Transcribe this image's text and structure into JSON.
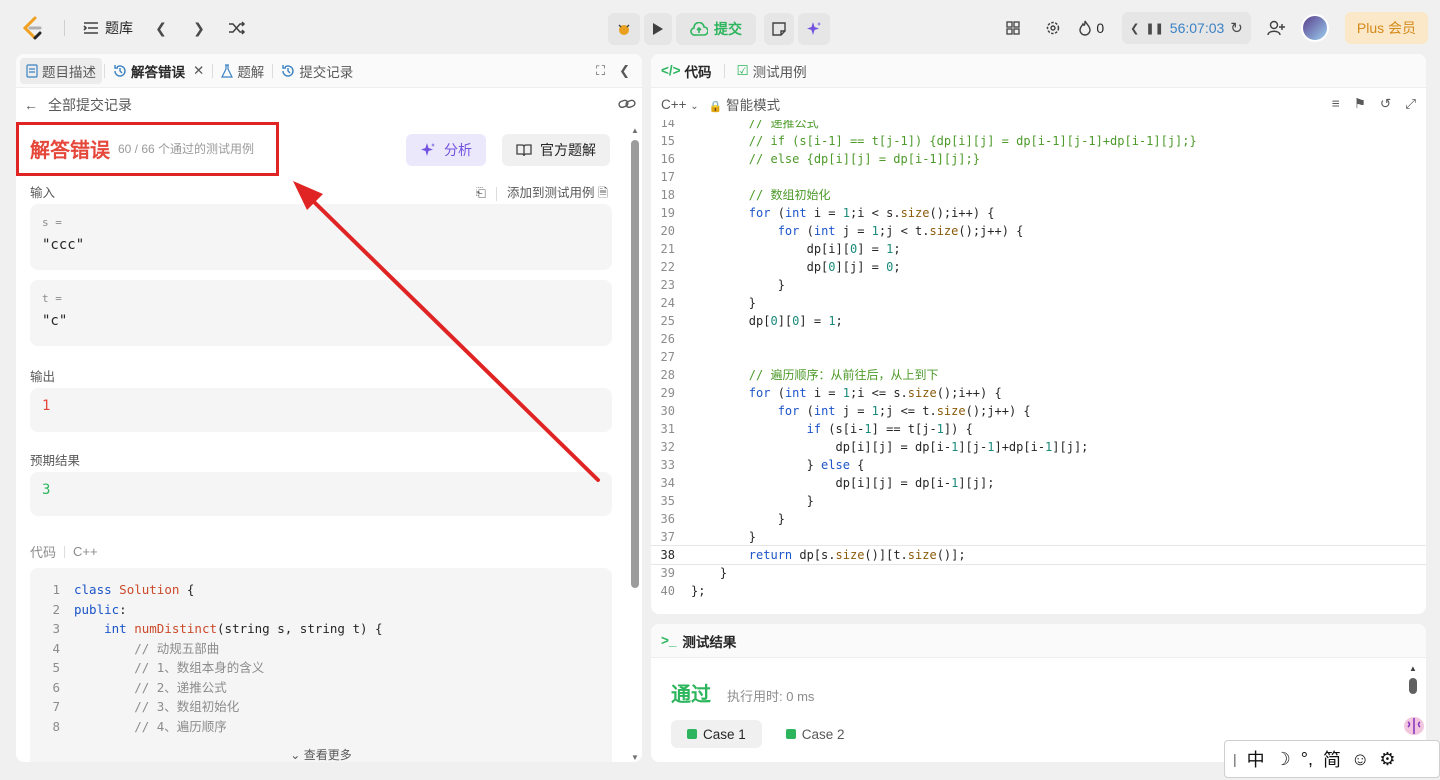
{
  "topbar": {
    "problems_label": "题库",
    "submit_label": "提交",
    "streak": "0",
    "timer": "56:07:03",
    "plus_label": "Plus 会员"
  },
  "left": {
    "tabs": [
      {
        "label": "题目描述"
      },
      {
        "label": "解答错误"
      },
      {
        "label": "题解"
      },
      {
        "label": "提交记录"
      }
    ],
    "back_label": "全部提交记录",
    "result_title": "解答错误",
    "result_sub": "60 / 66 个通过的测试用例",
    "analyze_label": "分析",
    "official_label": "官方题解",
    "input_label": "输入",
    "add_testcase_label": "添加到测试用例",
    "inputs": [
      {
        "var": "s =",
        "value": "\"ccc\""
      },
      {
        "var": "t =",
        "value": "\"c\""
      }
    ],
    "output_label": "输出",
    "output_value": "1",
    "expected_label": "预期结果",
    "expected_value": "3",
    "code_label": "代码",
    "code_lang": "C++",
    "see_more": "查看更多"
  },
  "code_panel": {
    "tab_code": "代码",
    "tab_testcase": "测试用例",
    "lang": "C++",
    "mode": "智能模式"
  },
  "result_panel": {
    "title": "测试结果",
    "status": "通过",
    "runtime": "执行用时: 0 ms",
    "cases": [
      "Case 1",
      "Case 2"
    ]
  },
  "ime": {
    "zh": "中",
    "punct": "°,",
    "simplified": "简"
  },
  "colors": {
    "error": "#e5483b",
    "success": "#2db55d",
    "annotation": "#e02424",
    "analyze": "#7253e0"
  }
}
